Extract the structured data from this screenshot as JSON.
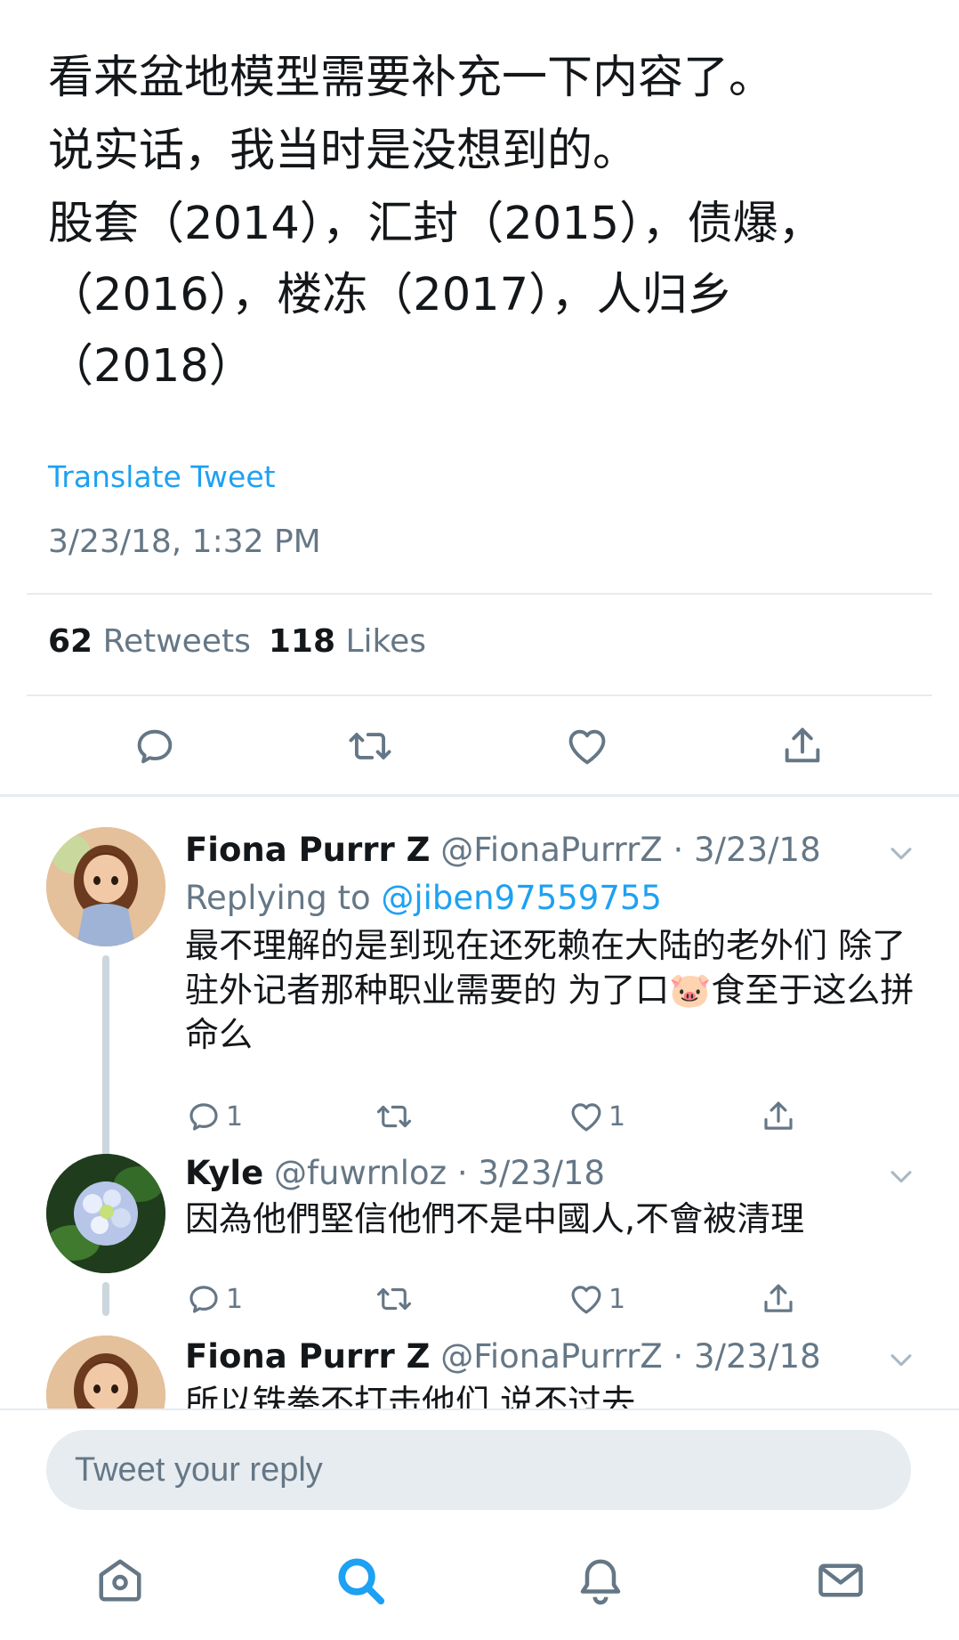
{
  "tweet": {
    "lines": [
      "看来盆地模型需要补充一下内容了。",
      "说实话，我当时是没想到的。",
      "股套（2014），汇封（2015），债爆，（2016），楼冻（2017），人归乡（2018）"
    ],
    "translate_label": "Translate Tweet",
    "timestamp": "3/23/18, 1:32 PM",
    "retweets_count": "62",
    "retweets_label": "Retweets",
    "likes_count": "118",
    "likes_label": "Likes"
  },
  "replies": [
    {
      "name": "Fiona Purrr Z",
      "handle": "@FionaPurrrZ",
      "date": "· 3/23/18",
      "replying_prefix": "Replying to",
      "replying_to": "@jiben97559755",
      "text": "最不理解的是到现在还死赖在大陆的老外们 除了驻外记者那种职业需要的 为了口🐷食至于这么拼命么",
      "reply_count": "1",
      "retweet_count": "",
      "like_count": "1"
    },
    {
      "name": "Kyle",
      "handle": "@fuwrnloz",
      "date": "· 3/23/18",
      "text": "因為他們堅信他們不是中國人,不會被清理",
      "reply_count": "1",
      "retweet_count": "",
      "like_count": "1"
    },
    {
      "name": "Fiona Purrr Z",
      "handle": "@FionaPurrrZ",
      "date": "· 3/23/18",
      "text": "所以铁拳不打击他们 说不过去"
    }
  ],
  "compose": {
    "placeholder": "Tweet your reply"
  },
  "colors": {
    "accent": "#1da1f2",
    "muted": "#657786",
    "divider": "#e6ecf0"
  },
  "icons": {
    "tweet_actions": [
      "reply-icon",
      "retweet-icon",
      "like-icon",
      "share-icon"
    ],
    "tabbar": [
      "home-icon",
      "search-icon",
      "notifications-icon",
      "messages-icon"
    ]
  }
}
